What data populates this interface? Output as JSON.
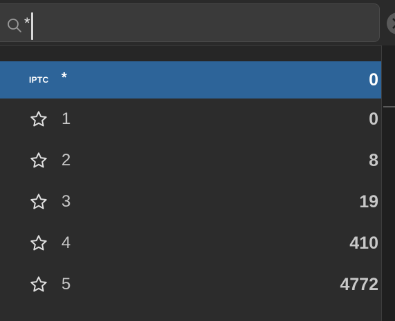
{
  "search": {
    "value": "*"
  },
  "list": {
    "selected": {
      "tag": "IPTC",
      "label": "*",
      "count": "0"
    },
    "items": [
      {
        "label": "1",
        "count": "0"
      },
      {
        "label": "2",
        "count": "8"
      },
      {
        "label": "3",
        "count": "19"
      },
      {
        "label": "4",
        "count": "410"
      },
      {
        "label": "5",
        "count": "4772"
      }
    ]
  },
  "icons": {
    "search": "search-icon",
    "clear": "close-icon",
    "rating": "star-outline-icon"
  },
  "colors": {
    "selection": "#2d6499",
    "background": "#2c2c2c",
    "text": "#c8c8c8"
  }
}
